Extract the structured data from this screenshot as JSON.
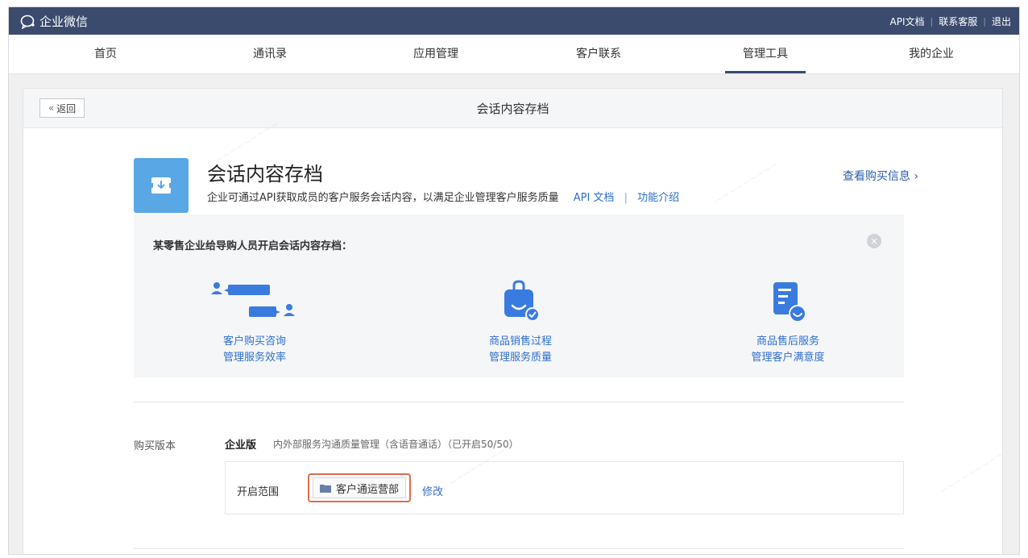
{
  "topbar": {
    "brand": "企业微信",
    "links": [
      "API文档",
      "联系客服",
      "退出"
    ]
  },
  "nav": {
    "tabs": [
      "首页",
      "通讯录",
      "应用管理",
      "客户联系",
      "管理工具",
      "我的企业"
    ],
    "active": "管理工具"
  },
  "page": {
    "back_label": "返回",
    "title": "会话内容存档"
  },
  "app": {
    "title": "会话内容存档",
    "description": "企业可通过API获取成员的客户服务会话内容，以满足企业管理客户服务质量",
    "api_doc_link": "API 文档",
    "separator": "|",
    "intro_link": "功能介绍",
    "buy_info_link": "查看购买信息 ›"
  },
  "panel": {
    "title": "某零售企业给导购人员开启会话内容存档：",
    "features": [
      {
        "line1": "客户购买咨询",
        "line2": "管理服务效率",
        "icon": "chat-users-icon"
      },
      {
        "line1": "商品销售过程",
        "line2": "管理服务质量",
        "icon": "shopping-bag-check-icon"
      },
      {
        "line1": "商品售后服务",
        "line2": "管理客户满意度",
        "icon": "document-smile-icon"
      }
    ]
  },
  "purchase": {
    "label": "购买版本",
    "edition": "企业版",
    "edition_desc": "内外部服务沟通质量管理（含语音通话）（已开启50/50）",
    "scope_label": "开启范围",
    "department": "客户通运营部",
    "modify_link": "修改"
  },
  "colors": {
    "topbar": "#3a4b6e",
    "link": "#2e6ecd",
    "accent_icon": "#3a7be0",
    "highlight_border": "#e06b50"
  }
}
